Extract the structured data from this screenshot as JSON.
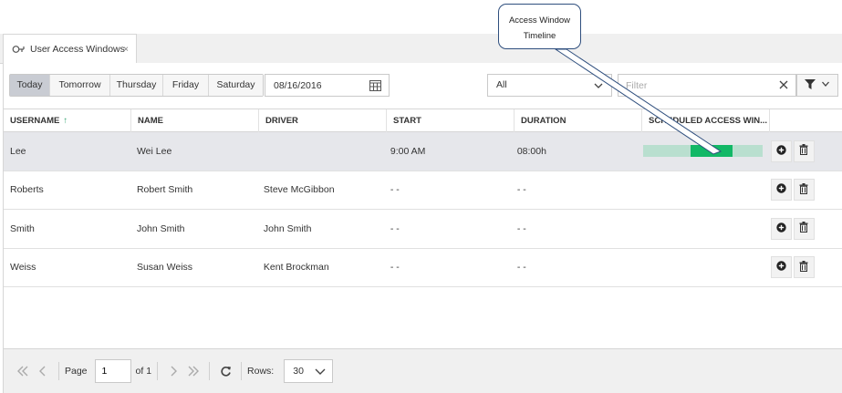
{
  "tab": {
    "label": "User Access Windows",
    "close": "×"
  },
  "toolbar": {
    "days": [
      "Today",
      "Tomorrow",
      "Thursday",
      "Friday",
      "Saturday"
    ],
    "active_day": "Today",
    "date_value": "08/16/2016",
    "select_value": "All",
    "filter_placeholder": "Filter"
  },
  "grid": {
    "columns": [
      "USERNAME",
      "NAME",
      "DRIVER",
      "START",
      "DURATION",
      "SCHEDULED ACCESS WIN..."
    ],
    "sort_indicator": "↑",
    "rows": [
      {
        "username": "Lee",
        "name": "Wei Lee",
        "driver": "",
        "start": "9:00 AM",
        "duration": "08:00h",
        "timeline": {
          "start_fraction": 0.4,
          "end_fraction": 0.75
        }
      },
      {
        "username": "Roberts",
        "name": "Robert Smith",
        "driver": "Steve McGibbon",
        "start": "- -",
        "duration": "- -"
      },
      {
        "username": "Smith",
        "name": "John Smith",
        "driver": "John Smith",
        "start": "- -",
        "duration": "- -"
      },
      {
        "username": "Weiss",
        "name": "Susan Weiss",
        "driver": "Kent Brockman",
        "start": "- -",
        "duration": "- -"
      }
    ]
  },
  "footer": {
    "page_label": "Page",
    "page_value": "1",
    "of_label": "of 1",
    "rows_label": "Rows:",
    "rows_value": "30"
  },
  "callout": {
    "line1": "Access Window",
    "line2": "Timeline"
  },
  "colors": {
    "timeline_track": "#b9dfcf",
    "timeline_fill": "#12b866",
    "sort_arrow": "#3aa676"
  }
}
